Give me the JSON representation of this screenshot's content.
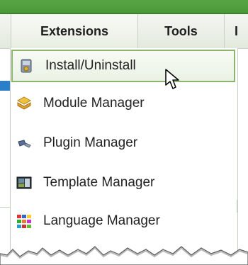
{
  "menubar": {
    "tabs": [
      {
        "label": "Extensions"
      },
      {
        "label": "Tools"
      },
      {
        "label": "I"
      }
    ]
  },
  "dropdown": {
    "items": [
      {
        "label": "Install/Uninstall",
        "icon": "install-icon",
        "active": true
      },
      {
        "label": "Module Manager",
        "icon": "module-icon"
      },
      {
        "label": "Plugin Manager",
        "icon": "plugin-icon"
      },
      {
        "label": "Template Manager",
        "icon": "template-icon"
      },
      {
        "label": "Language Manager",
        "icon": "language-icon"
      }
    ]
  },
  "colors": {
    "top_bar": "#4a9a3a",
    "active_border": "#8bb46f",
    "accent_blue": "#2a7fc8"
  }
}
